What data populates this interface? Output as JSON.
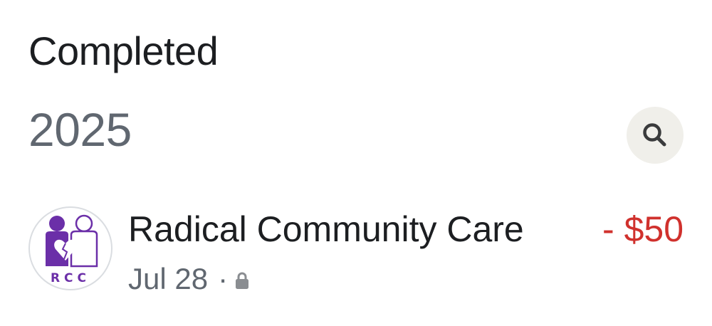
{
  "header": {
    "title": "Completed"
  },
  "filter": {
    "year": "2025",
    "search_icon": "search-icon"
  },
  "transactions": [
    {
      "merchant": "Radical Community Care",
      "avatar_text": "RCC",
      "date": "Jul 28",
      "separator": "·",
      "visibility_icon": "lock-icon",
      "amount": "- $50",
      "amount_color": "#d0312d"
    }
  ],
  "colors": {
    "brand_purple": "#6b2fa8",
    "muted_text": "#606770",
    "negative_amount": "#d0312d",
    "search_bg": "#f0efea"
  }
}
